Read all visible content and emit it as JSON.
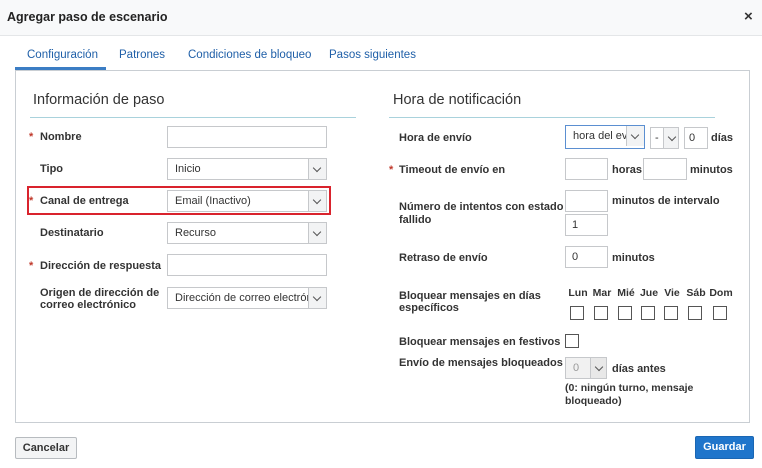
{
  "dialog": {
    "title": "Agregar paso de escenario",
    "close": "×"
  },
  "tabs": [
    {
      "label": "Configuración"
    },
    {
      "label": "Patrones"
    },
    {
      "label": "Condiciones de bloqueo"
    },
    {
      "label": "Pasos siguientes"
    }
  ],
  "left": {
    "title": "Información de paso",
    "required_marker": "*",
    "nombre": {
      "label": "Nombre",
      "value": ""
    },
    "tipo": {
      "label": "Tipo",
      "value": "Inicio"
    },
    "canal": {
      "label": "Canal de entrega",
      "value": "Email (Inactivo)"
    },
    "destinatario": {
      "label": "Destinatario",
      "value": "Recurso"
    },
    "direccion": {
      "label": "Dirección de respuesta",
      "value": ""
    },
    "origen": {
      "label_line1": "Origen de dirección de",
      "label_line2": "correo electrónico",
      "value": "Dirección de correo electrór"
    }
  },
  "right": {
    "title": "Hora de notificación",
    "hora_envio": {
      "label": "Hora de envío",
      "select_value": "hora del ev",
      "small_select_value": "-",
      "number": "0",
      "unit": "días"
    },
    "timeout": {
      "label": "Timeout de envío en",
      "hours_value": "",
      "hours_unit": "horas",
      "minutes_value": "",
      "minutes_unit": "minutos"
    },
    "intentos": {
      "label_line1": "Número de intentos con estado",
      "label_line2": "fallido",
      "interval_value": "",
      "interval_unit": "minutos de intervalo",
      "count_value": "1"
    },
    "retraso": {
      "label": "Retraso de envío",
      "value": "0",
      "unit": "minutos"
    },
    "bloquear_dias": {
      "label_line1": "Bloquear mensajes en días",
      "label_line2": "específicos",
      "days": [
        "Lun",
        "Mar",
        "Mié",
        "Jue",
        "Vie",
        "Sáb",
        "Dom"
      ]
    },
    "festivos": {
      "label": "Bloquear mensajes en festivos"
    },
    "bloqueados": {
      "label": "Envío de mensajes bloqueados",
      "value": "0",
      "unit": "días antes",
      "note_line1": "(0: ningún turno, mensaje",
      "note_line2": "bloqueado)"
    }
  },
  "footer": {
    "cancel": "Cancelar",
    "save": "Guardar"
  }
}
